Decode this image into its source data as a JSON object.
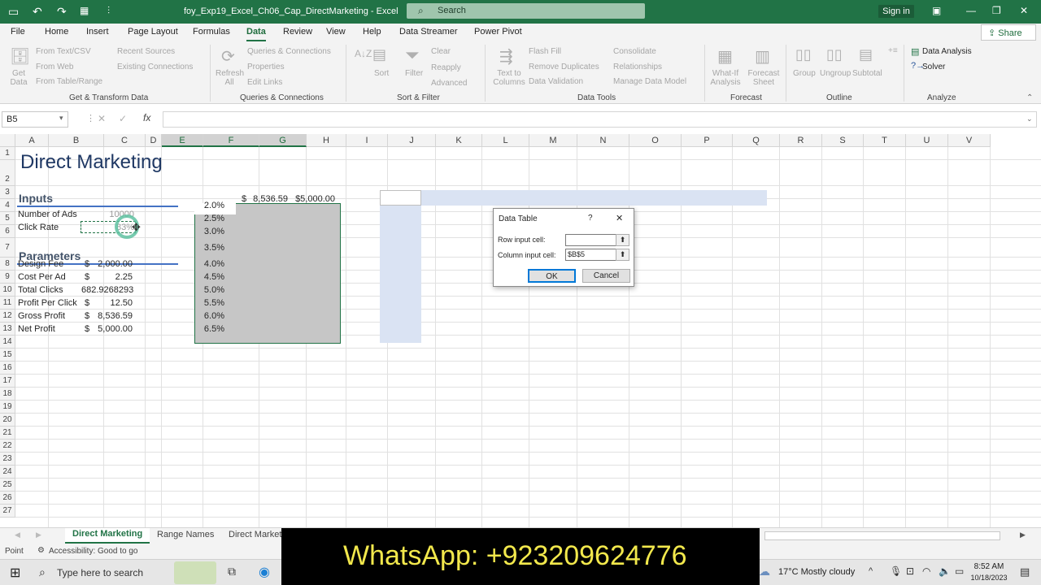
{
  "window": {
    "title": "foy_Exp19_Excel_Ch06_Cap_DirectMarketing - Excel",
    "search_placeholder": "Search",
    "signin": "Sign in"
  },
  "ribbon_tabs": [
    "File",
    "Home",
    "Insert",
    "Page Layout",
    "Formulas",
    "Data",
    "Review",
    "View",
    "Help",
    "Data Streamer",
    "Power Pivot"
  ],
  "active_tab": "Data",
  "share_label": "Share",
  "ribbon": {
    "get_data": "Get Data",
    "from_text": "From Text/CSV",
    "from_web": "From Web",
    "from_table": "From Table/Range",
    "recent_sources": "Recent Sources",
    "existing_connections": "Existing Connections",
    "group_get": "Get & Transform Data",
    "refresh_all": "Refresh All",
    "queries_connections": "Queries & Connections",
    "properties": "Properties",
    "edit_links": "Edit Links",
    "group_queries": "Queries & Connections",
    "sort": "Sort",
    "filter": "Filter",
    "clear": "Clear",
    "reapply": "Reapply",
    "advanced": "Advanced",
    "group_sort": "Sort & Filter",
    "text_to_columns": "Text to Columns",
    "flash_fill": "Flash Fill",
    "remove_duplicates": "Remove Duplicates",
    "data_validation": "Data Validation",
    "consolidate": "Consolidate",
    "relationships": "Relationships",
    "manage_data_model": "Manage Data Model",
    "group_tools": "Data Tools",
    "whatif": "What-If Analysis",
    "forecast_sheet": "Forecast Sheet",
    "group_forecast": "Forecast",
    "group": "Group",
    "ungroup": "Ungroup",
    "subtotal": "Subtotal",
    "group_outline": "Outline",
    "data_analysis": "Data Analysis",
    "solver": "Solver",
    "group_analyze": "Analyze"
  },
  "namebox": "B5",
  "columns": [
    "A",
    "B",
    "C",
    "D",
    "E",
    "F",
    "G",
    "H",
    "I",
    "J",
    "K",
    "L",
    "M",
    "N",
    "O",
    "P",
    "Q",
    "R",
    "S",
    "T",
    "U",
    "V"
  ],
  "rows": [
    "1",
    "2",
    "3",
    "4",
    "5",
    "6",
    "7",
    "8",
    "9",
    "10",
    "11",
    "12",
    "13",
    "14",
    "15",
    "16",
    "17",
    "18",
    "19",
    "20",
    "21",
    "22",
    "23",
    "24",
    "25",
    "26",
    "27"
  ],
  "sheet": {
    "title": "Direct Marketing",
    "inputs_header": "Inputs",
    "num_ads_label": "Number of Ads",
    "num_ads_value": "10000",
    "click_rate_label": "Click Rate",
    "click_rate_value": "83%",
    "parameters_header": "Parameters",
    "params": [
      {
        "label": "Design Fee",
        "cur": "$",
        "value": "2,000.00"
      },
      {
        "label": "Cost Per Ad",
        "cur": "$",
        "value": "2.25"
      },
      {
        "label": "Total Clicks",
        "cur": "",
        "value": "682.9268293"
      },
      {
        "label": "Profit Per Click",
        "cur": "$",
        "value": "12.50"
      },
      {
        "label": "Gross Profit",
        "cur": "$",
        "value": "8,536.59"
      },
      {
        "label": "Net Profit",
        "cur": "$",
        "value": "5,000.00"
      }
    ],
    "table_f3_cur": "$",
    "table_f3": "8,536.59",
    "table_g3": "$5,000.00",
    "rates": [
      "2.0%",
      "2.5%",
      "3.0%",
      "3.5%",
      "4.0%",
      "4.5%",
      "5.0%",
      "5.5%",
      "6.0%",
      "6.5%"
    ]
  },
  "dialog": {
    "title": "Data Table",
    "help": "?",
    "close": "✕",
    "row_label": "Row input cell:",
    "row_value": "",
    "col_label": "Column input cell:",
    "col_value": "$B$5",
    "ok": "OK",
    "cancel": "Cancel"
  },
  "sheet_tabs": [
    "Direct Marketing",
    "Range Names",
    "Direct Marketi"
  ],
  "status": {
    "mode": "Point",
    "accessibility": "Accessibility: Good to go"
  },
  "taskbar": {
    "search": "Type here to search",
    "weather": "17°C  Mostly cloudy",
    "time": "8:52 AM",
    "date": "10/18/2023"
  },
  "overlay_text": "WhatsApp: +923209624776"
}
